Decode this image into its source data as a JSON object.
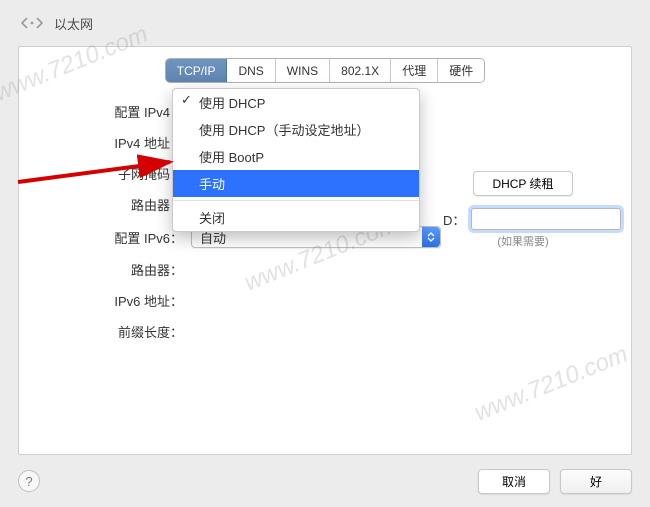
{
  "header": {
    "title": "以太网"
  },
  "tabs": {
    "tcpip": "TCP/IP",
    "dns": "DNS",
    "wins": "WINS",
    "dot1x": "802.1X",
    "proxy": "代理",
    "hardware": "硬件",
    "active": "tcpip"
  },
  "labels": {
    "configure_ipv4": "配置 IPv4：",
    "ipv4_address": "IPv4 地址：",
    "subnet_mask": "子网掩码：",
    "router_v4": "路由器：",
    "configure_ipv6": "配置 IPv6：",
    "router_v6": "路由器：",
    "ipv6_address": "IPv6 地址：",
    "prefix_length": "前缀长度：",
    "client_id_suffix": "D："
  },
  "ipv4_menu": {
    "use_dhcp": "使用 DHCP",
    "use_dhcp_manual": "使用 DHCP（手动设定地址）",
    "use_bootp": "使用 BootP",
    "manual": "手动",
    "off": "关闭",
    "selected": "use_dhcp",
    "highlighted": "manual"
  },
  "ipv6": {
    "value": "自动"
  },
  "buttons": {
    "dhcp_renew": "DHCP 续租",
    "cancel": "取消",
    "ok": "好"
  },
  "client_id": {
    "value": "",
    "hint": "(如果需要)"
  },
  "watermark": "www.7210.com"
}
